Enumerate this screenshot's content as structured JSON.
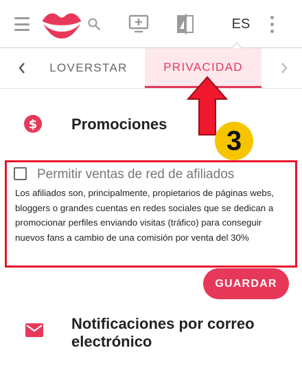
{
  "topbar": {
    "menu_icon": "hamburger-icon",
    "logo_icon": "lips-logo",
    "search_icon": "search-icon",
    "monitor_icon": "monitor-plus-icon",
    "mirror_icon": "compare-icon",
    "language": "ES",
    "more_icon": "more-vert-icon"
  },
  "tabs": {
    "prev_icon": "chevron-left-icon",
    "next_icon": "chevron-right-icon",
    "items": [
      {
        "label": "LOVERSTAR",
        "active": false
      },
      {
        "label": "PRIVACIDAD",
        "active": true
      }
    ]
  },
  "promotions": {
    "icon": "dollar-circle-icon",
    "title": "Promociones",
    "checkbox_label": "Permitir ventas de red de afiliados",
    "checkbox_checked": false,
    "description": "Los afiliados son, principalmente, propietarios de páginas webs, bloggers o grandes cuentas en redes sociales que se dedican a promocionar perfiles enviando visitas (tráfico) para conseguir nuevos fans a cambio de una comisión por venta del 30%"
  },
  "annotation": {
    "step_number": "3",
    "arrow_icon": "red-up-arrow",
    "highlight_color": "#e8142c",
    "badge_color": "#f7c500"
  },
  "actions": {
    "save_label": "GUARDAR"
  },
  "notifications": {
    "icon": "mail-icon",
    "title": "Notificaciones por correo electrónico"
  },
  "colors": {
    "accent": "#e8385a",
    "tab_active_bg": "#fde8ec"
  }
}
